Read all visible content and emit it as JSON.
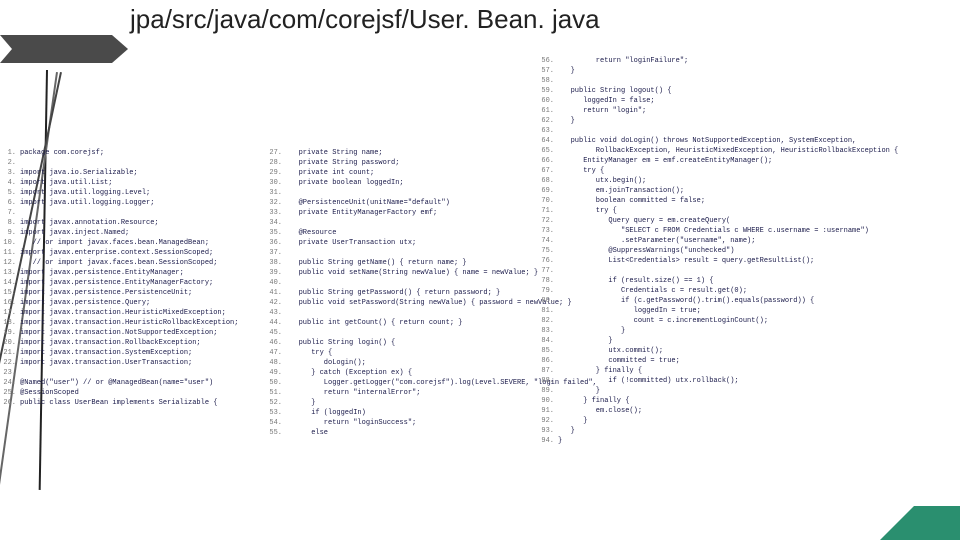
{
  "title": "jpa/src/java/com/corejsf/User. Bean. java",
  "columns": [
    [
      {
        "n": 1,
        "t": "package com.corejsf;"
      },
      {
        "n": 2,
        "t": ""
      },
      {
        "n": 3,
        "t": "import java.io.Serializable;"
      },
      {
        "n": 4,
        "t": "import java.util.List;"
      },
      {
        "n": 5,
        "t": "import java.util.logging.Level;"
      },
      {
        "n": 6,
        "t": "import java.util.logging.Logger;"
      },
      {
        "n": 7,
        "t": ""
      },
      {
        "n": 8,
        "t": "import javax.annotation.Resource;"
      },
      {
        "n": 9,
        "t": "import javax.inject.Named;"
      },
      {
        "n": 10,
        "t": "   // or import javax.faces.bean.ManagedBean;"
      },
      {
        "n": 11,
        "t": "import javax.enterprise.context.SessionScoped;"
      },
      {
        "n": 12,
        "t": "   // or import javax.faces.bean.SessionScoped;"
      },
      {
        "n": 13,
        "t": "import javax.persistence.EntityManager;"
      },
      {
        "n": 14,
        "t": "import javax.persistence.EntityManagerFactory;"
      },
      {
        "n": 15,
        "t": "import javax.persistence.PersistenceUnit;"
      },
      {
        "n": 16,
        "t": "import javax.persistence.Query;"
      },
      {
        "n": 17,
        "t": "import javax.transaction.HeuristicMixedException;"
      },
      {
        "n": 18,
        "t": "import javax.transaction.HeuristicRollbackException;"
      },
      {
        "n": 19,
        "t": "import javax.transaction.NotSupportedException;"
      },
      {
        "n": 20,
        "t": "import javax.transaction.RollbackException;"
      },
      {
        "n": 21,
        "t": "import javax.transaction.SystemException;"
      },
      {
        "n": 22,
        "t": "import javax.transaction.UserTransaction;"
      },
      {
        "n": 23,
        "t": ""
      },
      {
        "n": 24,
        "t": "@Named(\"user\") // or @ManagedBean(name=\"user\")"
      },
      {
        "n": 25,
        "t": "@SessionScoped"
      },
      {
        "n": 26,
        "t": "public class UserBean implements Serializable {"
      }
    ],
    [
      {
        "n": 27,
        "t": "   private String name;"
      },
      {
        "n": 28,
        "t": "   private String password;"
      },
      {
        "n": 29,
        "t": "   private int count;"
      },
      {
        "n": 30,
        "t": "   private boolean loggedIn;"
      },
      {
        "n": 31,
        "t": ""
      },
      {
        "n": 32,
        "t": "   @PersistenceUnit(unitName=\"default\")"
      },
      {
        "n": 33,
        "t": "   private EntityManagerFactory emf;"
      },
      {
        "n": 34,
        "t": ""
      },
      {
        "n": 35,
        "t": "   @Resource"
      },
      {
        "n": 36,
        "t": "   private UserTransaction utx;"
      },
      {
        "n": 37,
        "t": ""
      },
      {
        "n": 38,
        "t": "   public String getName() { return name; }"
      },
      {
        "n": 39,
        "t": "   public void setName(String newValue) { name = newValue; }"
      },
      {
        "n": 40,
        "t": ""
      },
      {
        "n": 41,
        "t": "   public String getPassword() { return password; }"
      },
      {
        "n": 42,
        "t": "   public void setPassword(String newValue) { password = newValue; }"
      },
      {
        "n": 43,
        "t": ""
      },
      {
        "n": 44,
        "t": "   public int getCount() { return count; }"
      },
      {
        "n": 45,
        "t": ""
      },
      {
        "n": 46,
        "t": "   public String login() {"
      },
      {
        "n": 47,
        "t": "      try {"
      },
      {
        "n": 48,
        "t": "         doLogin();"
      },
      {
        "n": 49,
        "t": "      } catch (Exception ex) {"
      },
      {
        "n": 50,
        "t": "         Logger.getLogger(\"com.corejsf\").log(Level.SEVERE, \"login failed\","
      },
      {
        "n": 51,
        "t": "         return \"internalError\";"
      },
      {
        "n": 52,
        "t": "      }"
      },
      {
        "n": 53,
        "t": "      if (loggedIn)"
      },
      {
        "n": 54,
        "t": "         return \"loginSuccess\";"
      },
      {
        "n": 55,
        "t": "      else"
      }
    ],
    [
      {
        "n": 56,
        "t": "         return \"loginFailure\";"
      },
      {
        "n": 57,
        "t": "   }"
      },
      {
        "n": 58,
        "t": ""
      },
      {
        "n": 59,
        "t": "   public String logout() {"
      },
      {
        "n": 60,
        "t": "      loggedIn = false;"
      },
      {
        "n": 61,
        "t": "      return \"login\";"
      },
      {
        "n": 62,
        "t": "   }"
      },
      {
        "n": 63,
        "t": ""
      },
      {
        "n": 64,
        "t": "   public void doLogin() throws NotSupportedException, SystemException,"
      },
      {
        "n": 65,
        "t": "         RollbackException, HeuristicMixedException, HeuristicRollbackException {"
      },
      {
        "n": 66,
        "t": "      EntityManager em = emf.createEntityManager();"
      },
      {
        "n": 67,
        "t": "      try {"
      },
      {
        "n": 68,
        "t": "         utx.begin();"
      },
      {
        "n": 69,
        "t": "         em.joinTransaction();"
      },
      {
        "n": 70,
        "t": "         boolean committed = false;"
      },
      {
        "n": 71,
        "t": "         try {"
      },
      {
        "n": 72,
        "t": "            Query query = em.createQuery("
      },
      {
        "n": 73,
        "t": "               \"SELECT c FROM Credentials c WHERE c.username = :username\")"
      },
      {
        "n": 74,
        "t": "               .setParameter(\"username\", name);"
      },
      {
        "n": 75,
        "t": "            @SuppressWarnings(\"unchecked\")"
      },
      {
        "n": 76,
        "t": "            List<Credentials> result = query.getResultList();"
      },
      {
        "n": 77,
        "t": ""
      },
      {
        "n": 78,
        "t": "            if (result.size() == 1) {"
      },
      {
        "n": 79,
        "t": "               Credentials c = result.get(0);"
      },
      {
        "n": 80,
        "t": "               if (c.getPassword().trim().equals(password)) {"
      },
      {
        "n": 81,
        "t": "                  loggedIn = true;"
      },
      {
        "n": 82,
        "t": "                  count = c.incrementLoginCount();"
      },
      {
        "n": 83,
        "t": "               }"
      },
      {
        "n": 84,
        "t": "            }"
      },
      {
        "n": 85,
        "t": "            utx.commit();"
      },
      {
        "n": 86,
        "t": "            committed = true;"
      },
      {
        "n": 87,
        "t": "         } finally {"
      },
      {
        "n": 88,
        "t": "            if (!committed) utx.rollback();"
      },
      {
        "n": 89,
        "t": "         }"
      },
      {
        "n": 90,
        "t": "      } finally {"
      },
      {
        "n": 91,
        "t": "         em.close();"
      },
      {
        "n": 92,
        "t": "      }"
      },
      {
        "n": 93,
        "t": "   }"
      },
      {
        "n": 94,
        "t": "}"
      }
    ]
  ]
}
